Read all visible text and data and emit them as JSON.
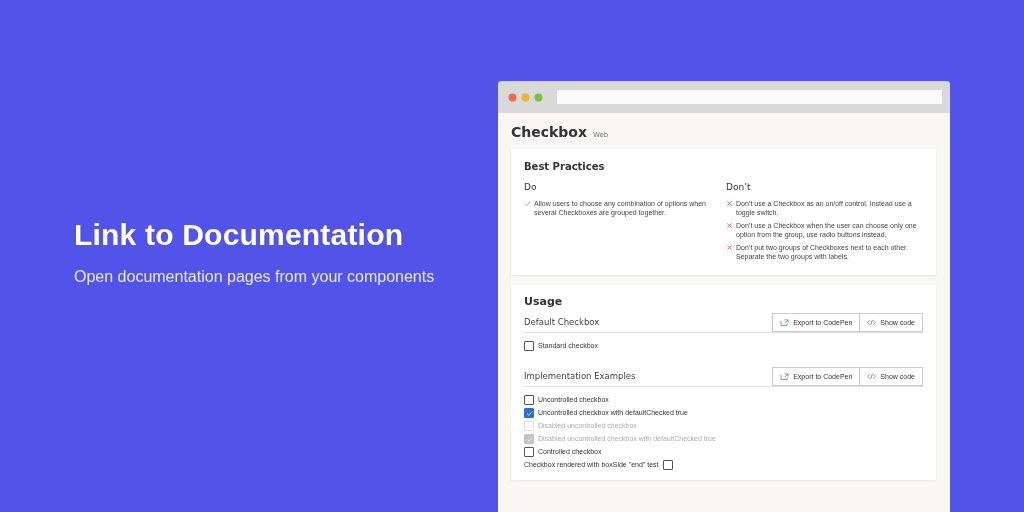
{
  "hero": {
    "title": "Link to Documentation",
    "subtitle": "Open documentation pages from your components"
  },
  "page": {
    "title": "Checkbox",
    "badge": "Web"
  },
  "best_practices": {
    "heading": "Best Practices",
    "do": {
      "heading": "Do",
      "items": [
        "Allow users to choose any combination of options when several Checkboxes are grouped together."
      ]
    },
    "dont": {
      "heading": "Don’t",
      "items": [
        "Don’t use a Checkbox as an on/off control. Instead use a toggle switch.",
        "Don’t use a Checkbox when the user can choose only one option from the group, use radio buttons instead.",
        "Don’t put two groups of Checkboxes next to each other. Separate the two groups with labels."
      ]
    }
  },
  "usage": {
    "heading": "Usage",
    "sections": [
      {
        "heading": "Default Checkbox",
        "buttons": [
          {
            "kind": "export",
            "label": "Export to CodePen"
          },
          {
            "kind": "code",
            "label": "Show code"
          }
        ],
        "checkboxes": [
          {
            "kind": "box-start",
            "label": "Standard checkbox",
            "checked": false,
            "disabled": false
          }
        ]
      },
      {
        "heading": "Implementation Examples",
        "buttons": [
          {
            "kind": "export",
            "label": "Export to CodePen"
          },
          {
            "kind": "code",
            "label": "Show code"
          }
        ],
        "checkboxes": [
          {
            "kind": "box-start",
            "label": "Uncontrolled checkbox",
            "checked": false,
            "disabled": false
          },
          {
            "kind": "box-start",
            "label": "Uncontrolled checkbox with defaultChecked true",
            "checked": true,
            "disabled": false
          },
          {
            "kind": "box-start",
            "label": "Disabled uncontrolled checkbox",
            "checked": false,
            "disabled": true
          },
          {
            "kind": "box-start",
            "label": "Disabled uncontrolled checkbox with defaultChecked true",
            "checked": true,
            "disabled": true
          },
          {
            "kind": "box-start",
            "label": "Controlled checkbox",
            "checked": false,
            "disabled": false
          },
          {
            "kind": "box-end",
            "label": "Checkbox rendered with boxSide \"end\" test",
            "checked": false,
            "disabled": false
          }
        ]
      }
    ]
  }
}
